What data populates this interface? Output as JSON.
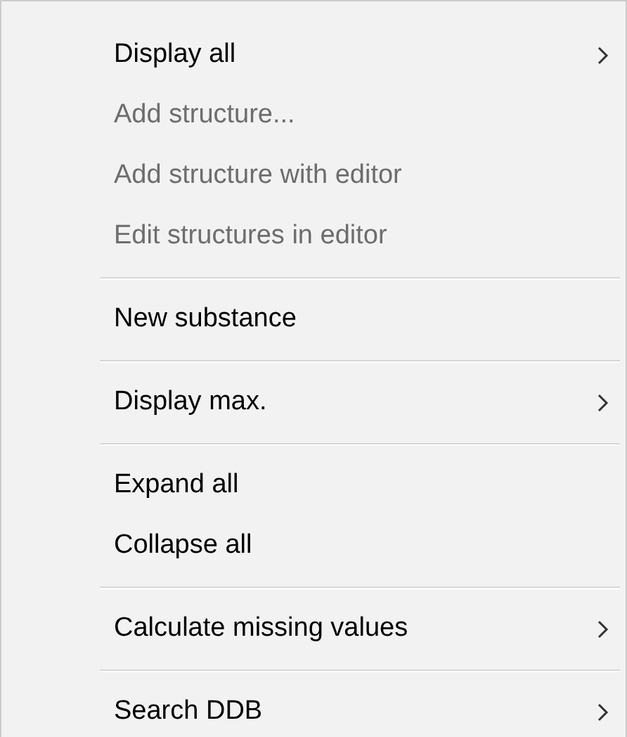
{
  "menu": {
    "groups": [
      {
        "items": [
          {
            "label": "Display all",
            "disabled": false,
            "submenu": true
          },
          {
            "label": "Add structure...",
            "disabled": true,
            "submenu": false
          },
          {
            "label": "Add structure with editor",
            "disabled": true,
            "submenu": false
          },
          {
            "label": "Edit structures in editor",
            "disabled": true,
            "submenu": false
          }
        ]
      },
      {
        "items": [
          {
            "label": "New substance",
            "disabled": false,
            "submenu": false
          }
        ]
      },
      {
        "items": [
          {
            "label": "Display max.",
            "disabled": false,
            "submenu": true
          }
        ]
      },
      {
        "items": [
          {
            "label": "Expand all",
            "disabled": false,
            "submenu": false
          },
          {
            "label": "Collapse all",
            "disabled": false,
            "submenu": false
          }
        ]
      },
      {
        "items": [
          {
            "label": "Calculate missing values",
            "disabled": false,
            "submenu": true
          }
        ]
      },
      {
        "items": [
          {
            "label": "Search DDB",
            "disabled": false,
            "submenu": true
          }
        ]
      }
    ]
  }
}
